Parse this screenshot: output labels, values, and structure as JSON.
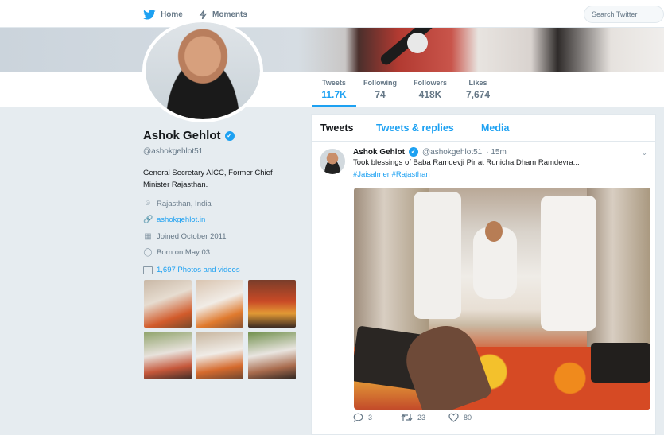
{
  "nav": {
    "home": "Home",
    "moments": "Moments",
    "search_placeholder": "Search Twitter"
  },
  "stats": [
    {
      "label": "Tweets",
      "value": "11.7K",
      "active": true
    },
    {
      "label": "Following",
      "value": "74",
      "active": false
    },
    {
      "label": "Followers",
      "value": "418K",
      "active": false
    },
    {
      "label": "Likes",
      "value": "7,674",
      "active": false
    }
  ],
  "profile": {
    "name": "Ashok Gehlot",
    "handle": "@ashokgehlot51",
    "bio": "General Secretary AICC, Former Chief Minister Rajasthan.",
    "location": "Rajasthan, India",
    "website": "ashokgehlot.in",
    "joined": "Joined October 2011",
    "born": "Born on May 03",
    "photos_label": "1,697 Photos and videos"
  },
  "tabs": [
    "Tweets",
    "Tweets & replies",
    "Media"
  ],
  "tweet": {
    "name": "Ashok Gehlot",
    "handle": "@ashokgehlot51",
    "time": "· 15m",
    "text": "Took blessings of Baba Ramdevji Pir at Runicha Dham Ramdevra...",
    "hashtags": "#Jaisalmer #Rajasthan",
    "replies": "3",
    "retweets": "23",
    "likes": "80"
  },
  "icons": {
    "brand": "twitter-bird-icon",
    "moments": "lightning-icon",
    "location": "location-pin-icon",
    "link": "link-icon",
    "calendar": "calendar-icon",
    "birthday": "balloon-icon",
    "photos": "photo-icon",
    "reply": "reply-icon",
    "retweet": "retweet-icon",
    "like": "heart-icon",
    "verified": "verified-icon"
  },
  "colors": {
    "accent": "#1da1f2",
    "text": "#14171a",
    "secondary": "#657786",
    "background": "#e6ecf0"
  }
}
